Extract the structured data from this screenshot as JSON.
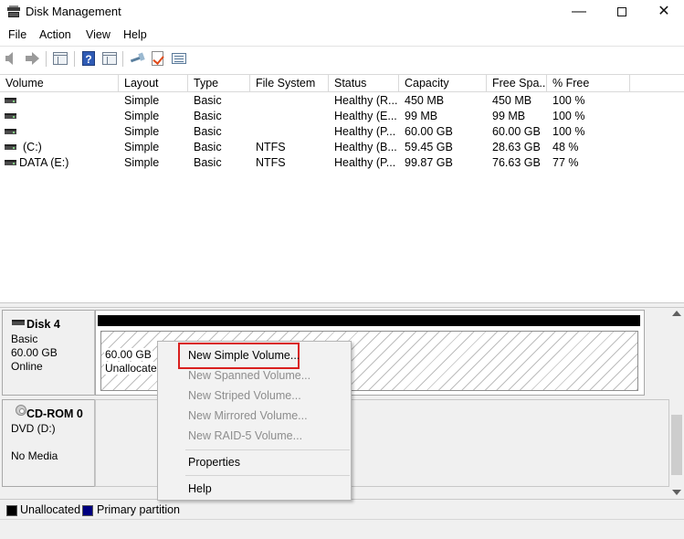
{
  "window": {
    "title": "Disk Management",
    "minimize": "—",
    "close": "✕"
  },
  "menu": {
    "file": "File",
    "action": "Action",
    "view": "View",
    "help": "Help"
  },
  "toolbar": {
    "icons": [
      "back-arrow-icon",
      "forward-arrow-icon",
      "console-tree-icon",
      "help-icon",
      "properties-icon",
      "rescan-icon",
      "checklist-icon",
      "volume-list-icon"
    ],
    "help_glyph": "?"
  },
  "volume_table": {
    "columns": [
      "Volume",
      "Layout",
      "Type",
      "File System",
      "Status",
      "Capacity",
      "Free Spa...",
      "% Free"
    ],
    "rows": [
      {
        "volume": "",
        "layout": "Simple",
        "type": "Basic",
        "fs": "",
        "status": "Healthy (R...",
        "capacity": "450 MB",
        "free": "450 MB",
        "pct": "100 %"
      },
      {
        "volume": "",
        "layout": "Simple",
        "type": "Basic",
        "fs": "",
        "status": "Healthy (E...",
        "capacity": "99 MB",
        "free": "99 MB",
        "pct": "100 %"
      },
      {
        "volume": "",
        "layout": "Simple",
        "type": "Basic",
        "fs": "",
        "status": "Healthy (P...",
        "capacity": "60.00 GB",
        "free": "60.00 GB",
        "pct": "100 %"
      },
      {
        "volume": "(C:)",
        "layout": "Simple",
        "type": "Basic",
        "fs": "NTFS",
        "status": "Healthy (B...",
        "capacity": "59.45 GB",
        "free": "28.63 GB",
        "pct": "48 %"
      },
      {
        "volume": "DATA (E:)",
        "layout": "Simple",
        "type": "Basic",
        "fs": "NTFS",
        "status": "Healthy (P...",
        "capacity": "99.87 GB",
        "free": "76.63 GB",
        "pct": "77 %"
      }
    ]
  },
  "disks": {
    "disk4": {
      "name": "Disk 4",
      "type": "Basic",
      "size": "60.00 GB",
      "state": "Online",
      "partition_size": "60.00 GB",
      "partition_status": "Unallocated"
    },
    "cdrom0": {
      "name": "CD-ROM 0",
      "drive": "DVD (D:)",
      "media": "No Media"
    }
  },
  "context_menu": {
    "new_simple": "New Simple Volume...",
    "new_spanned": "New Spanned Volume...",
    "new_striped": "New Striped Volume...",
    "new_mirrored": "New Mirrored Volume...",
    "new_raid5": "New RAID-5 Volume...",
    "properties": "Properties",
    "help": "Help"
  },
  "legend": {
    "unallocated": "Unallocated",
    "primary": "Primary partition"
  },
  "colors": {
    "unallocated": "#000000",
    "primary": "#00007f",
    "highlight_border": "#d9201f"
  }
}
